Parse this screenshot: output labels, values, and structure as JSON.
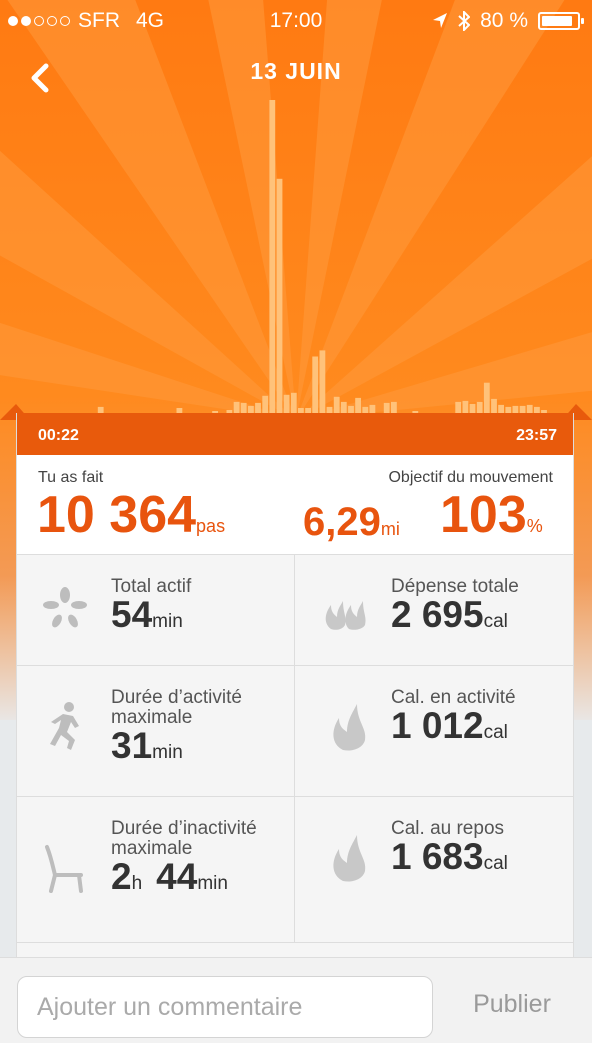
{
  "status": {
    "carrier": "SFR",
    "network": "4G",
    "time": "17:00",
    "battery_percent_label": "80 %",
    "battery_level": 0.8,
    "signal_bars": 2,
    "signal_total": 5
  },
  "nav": {
    "title": "13 JUIN",
    "back_icon": "chevron-left-icon"
  },
  "colors": {
    "accent": "#e8540e",
    "bar": "#ffc27a",
    "time_bar": "#e85a0c"
  },
  "chart_data": {
    "type": "bar",
    "title": "",
    "xlabel": "",
    "ylabel": "",
    "x_start_label": "00:22",
    "x_end_label": "23:57",
    "values": [
      0,
      0,
      0,
      0,
      0,
      0,
      0,
      0,
      6,
      0,
      0,
      0,
      0,
      0,
      0,
      0,
      0,
      0,
      0,
      5,
      0,
      0,
      0,
      0,
      2,
      0,
      3,
      11,
      10,
      7,
      10,
      17,
      310,
      232,
      18,
      20,
      5,
      5,
      56,
      62,
      6,
      16,
      11,
      7,
      15,
      6,
      8,
      0,
      10,
      11,
      0,
      0,
      2,
      0,
      0,
      0,
      0,
      0,
      11,
      12,
      9,
      11,
      30,
      14,
      8,
      6,
      7,
      7,
      8,
      6,
      3,
      0,
      0
    ]
  },
  "summary": {
    "left_label": "Tu as fait",
    "steps_value": "10 364",
    "steps_unit": "pas",
    "right_label": "Objectif du mouvement",
    "distance_value": "6,29",
    "distance_unit": "mi",
    "goal_value": "103",
    "goal_unit": "%"
  },
  "stats": [
    {
      "label": "Total actif",
      "value": "54",
      "unit": "min",
      "icon": "burst-icon"
    },
    {
      "label": "Dépense totale",
      "value": "2 695",
      "unit": "cal",
      "icon": "flames-icon"
    },
    {
      "label": "Durée d’activité maximale",
      "value": "31",
      "unit": "min",
      "icon": "runner-icon"
    },
    {
      "label": "Cal. en activité",
      "value": "1 012",
      "unit": "cal",
      "icon": "flame-icon"
    },
    {
      "label": "Durée d’inactivité maximale",
      "value": "2",
      "unit": "h",
      "value2": "44",
      "unit2": "min",
      "icon": "chair-icon"
    },
    {
      "label": "Cal. au repos",
      "value": "1 683",
      "unit": "cal",
      "icon": "flame-icon"
    }
  ],
  "comment": {
    "placeholder": "Ajouter un commentaire",
    "publish_label": "Publier"
  }
}
